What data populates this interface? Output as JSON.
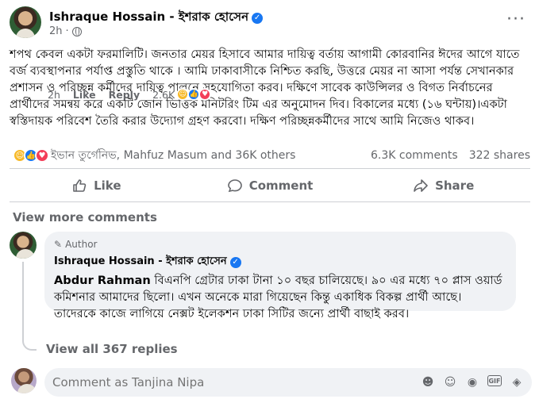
{
  "post": {
    "author": "Ishraque Hossain - ইশরাক হোসেন",
    "time": "2h",
    "more_label": "···",
    "text": "শপথ কেবল একটা ফরমালিটি। জনতার মেয়র হিসাবে আমার দায়িত্ব বর্তায় আগামী কোরবানির ঈদের আগে যাতে বর্জ ব্যবস্থাপনার পর্যাপ্ত প্রস্তুতি থাকে । আমি ঢাকাবাসীকে নিশ্চিত করছি, উত্তরে মেয়র না আসা পর্যন্ত সেখানকার প্রশাসন ও পরিচ্ছন্ন কর্মীদের দায়িত্ব পালনে সহযোগিতা করব। দক্ষিণে সাবেক কাউন্সিলর ও বিগত নির্বাচনের প্রার্থীদের সমন্বয় করে একটি জোন ভিত্তিক মনিটরিং টিম এর অনুমোদন দিব। বিকালের মধ্যে (১৬ ঘন্টায়)।একটা স্বস্তিদায়ক পরিবেশ তৈরি করার উদ্যোগ গ্রহণ করবো। দক্ষিণ পরিচ্ছন্নকর্মীদের সাথে আমি নিজেও থাকব।"
  },
  "reactions": {
    "summary": "ইভান তুর্গেনিভ, Mahfuz Masum and 36K others",
    "comments": "6.3K comments",
    "shares": "322 shares"
  },
  "actions": {
    "like": "Like",
    "comment": "Comment",
    "share": "Share"
  },
  "view_more_comments": "View more comments",
  "comment": {
    "tag": "Author",
    "author": "Ishraque Hossain - ইশরাক হোসেন",
    "mention": "Abdur Rahman",
    "text": " বিএনপি গ্রেটার ঢাকা টানা ১০ বছর চালিয়েছে। ৯০ এর মধ্যে ৭০ প্লাস ওয়ার্ড কমিশনার আমাদের ছিলো। এখন অনেকে মারা গিয়েছেন কিন্তু একাধিক বিকল্প প্রার্থী আছে। তাদেরকে কাজে লাগিয়ে নেক্সট ইলেকশন ঢাকা সিটির জন্যে প্রার্থী বাছাই করব।",
    "time": "2h",
    "like": "Like",
    "reply": "Reply",
    "reaction_count": "2.6K"
  },
  "view_all_replies": "View all 367 replies",
  "composer": {
    "placeholder": "Comment as Tanjina Nipa"
  },
  "colors": {
    "accent": "#1877f2",
    "secondary_text": "#65676b",
    "bubble": "#f0f2f5"
  }
}
